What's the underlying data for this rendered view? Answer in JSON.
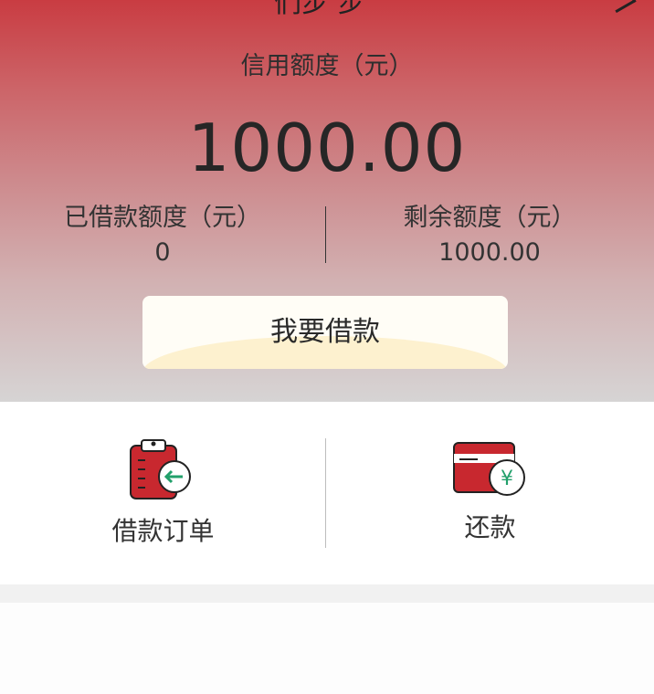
{
  "header": {
    "partial_title": "们步 步"
  },
  "credit": {
    "label": "信用额度（元）",
    "value": "1000.00"
  },
  "borrowed": {
    "label": "已借款额度（元）",
    "value": "0"
  },
  "remaining": {
    "label": "剩余额度（元）",
    "value": "1000.00"
  },
  "borrow_button": {
    "label": "我要借款"
  },
  "actions": [
    {
      "label": "借款订单",
      "icon": "clipboard-return-icon"
    },
    {
      "label": "还款",
      "icon": "card-yen-icon"
    }
  ],
  "colors": {
    "accent_red": "#c8282f",
    "icon_green": "#22a06b",
    "header_top": "#c93c42",
    "header_bottom": "#d6d4d4"
  }
}
